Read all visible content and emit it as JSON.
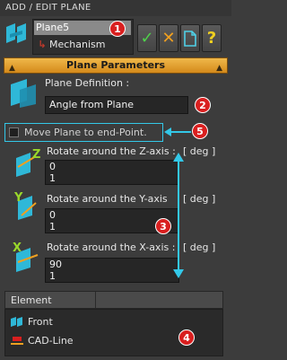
{
  "window": {
    "title": "ADD / EDIT PLANE"
  },
  "tree": {
    "selected": "Plane5",
    "child": "Mechanism"
  },
  "toolbar": {
    "ok_icon": "check-icon",
    "cancel_icon": "x-icon",
    "new_icon": "document-icon",
    "help_icon": "question-icon",
    "ok_color": "#4fd14a",
    "cancel_color": "#f0a020"
  },
  "section": {
    "title": "Plane Parameters"
  },
  "definition": {
    "label": "Plane Definition :",
    "value": "Angle from Plane"
  },
  "move_checkbox": {
    "label": "Move Plane to end-Point.",
    "checked": false
  },
  "rotations": [
    {
      "axis": "Z",
      "label": "Rotate around the Z-axis :",
      "unit": "[ deg ]",
      "value": "0",
      "step": "1"
    },
    {
      "axis": "Y",
      "label": "Rotate around the Y-axis",
      "unit": "[ deg ]",
      "value": "0",
      "step": "1"
    },
    {
      "axis": "X",
      "label": "Rotate around the X-axis :",
      "unit": "[ deg ]",
      "value": "90",
      "step": "1"
    }
  ],
  "elements": {
    "header": "Element",
    "items": [
      {
        "label": "Front"
      },
      {
        "label": "CAD-Line"
      }
    ]
  },
  "badges": [
    "1",
    "2",
    "3",
    "4",
    "5"
  ],
  "colors": {
    "accent": "#33c8e8",
    "badge": "#d91f1f",
    "section": "#e9a537"
  }
}
